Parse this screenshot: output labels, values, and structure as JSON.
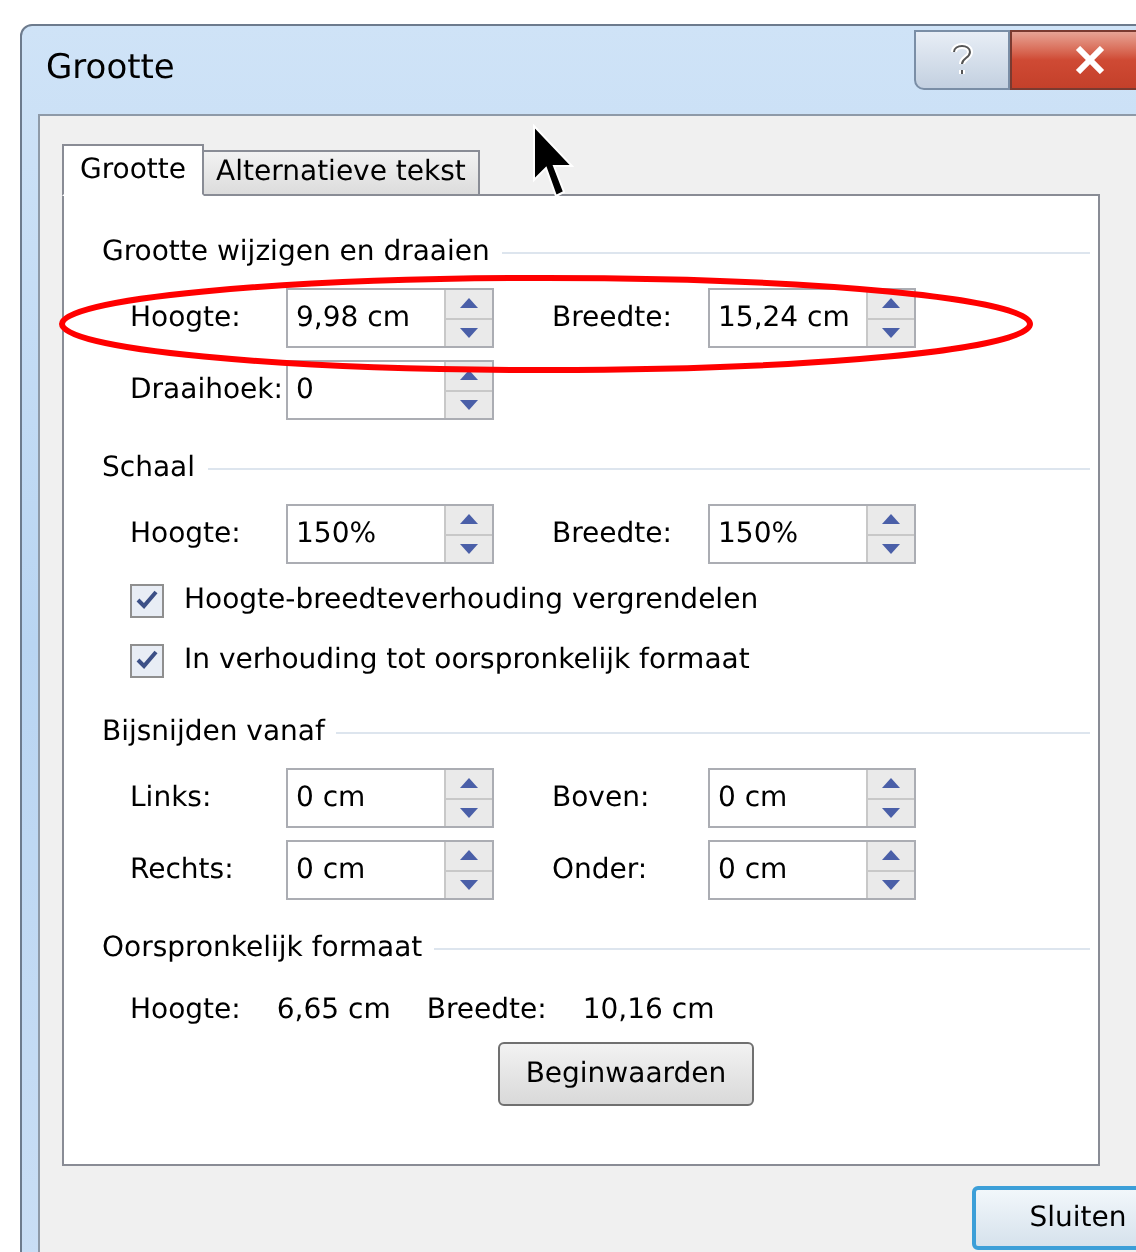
{
  "window": {
    "title": "Grootte"
  },
  "tabs": [
    {
      "label": "Grootte",
      "selected": true
    },
    {
      "label": "Alternatieve tekst",
      "selected": false
    }
  ],
  "sections": [
    {
      "title": "Grootte wijzigen en draaien",
      "rows": [
        {
          "kind": "fields",
          "fields": [
            {
              "label": "Hoogte:",
              "value": "9,98 cm"
            },
            {
              "label": "Breedte:",
              "value": "15,24 cm"
            }
          ]
        },
        {
          "kind": "fields",
          "fields": [
            {
              "label": "Draaihoek:",
              "value": "0"
            }
          ]
        }
      ]
    },
    {
      "title": "Schaal",
      "rows": [
        {
          "kind": "fields",
          "fields": [
            {
              "label": "Hoogte:",
              "value": "150%"
            },
            {
              "label": "Breedte:",
              "value": "150%"
            }
          ]
        },
        {
          "kind": "checkbox",
          "label": "Hoogte-breedteverhouding vergrendelen",
          "checked": true
        },
        {
          "kind": "checkbox",
          "label": "In verhouding tot oorspronkelijk formaat",
          "checked": true
        }
      ]
    },
    {
      "title": "Bijsnijden vanaf",
      "rows": [
        {
          "kind": "fields",
          "fields": [
            {
              "label": "Links:",
              "value": "0 cm"
            },
            {
              "label": "Boven:",
              "value": "0 cm"
            }
          ]
        },
        {
          "kind": "fields",
          "fields": [
            {
              "label": "Rechts:",
              "value": "0 cm"
            },
            {
              "label": "Onder:",
              "value": "0 cm"
            }
          ]
        }
      ]
    },
    {
      "title": "Oorspronkelijk formaat",
      "rows": [
        {
          "kind": "info",
          "items": [
            {
              "label": "Hoogte:",
              "value": "6,65 cm"
            },
            {
              "label": "Breedte:",
              "value": "10,16 cm"
            }
          ]
        },
        {
          "kind": "button",
          "label": "Beginwaarden"
        }
      ]
    }
  ],
  "buttons": [
    "Sluiten"
  ]
}
